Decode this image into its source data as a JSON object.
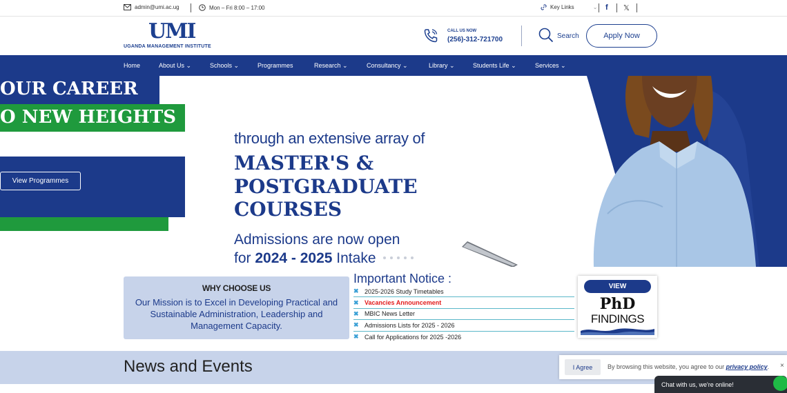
{
  "topbar": {
    "email": "admin@umi.ac.ug",
    "hours": "Mon – Fri 8:00 – 17:00",
    "key_links": "Key Links"
  },
  "header": {
    "logo_mark": "UMI",
    "logo_text": "UGANDA MANAGEMENT INSTITUTE",
    "call_label": "CALL US NOW",
    "call_number": "(256)-312-721700",
    "search_label": "Search",
    "apply_label": "Apply Now"
  },
  "nav": {
    "items": [
      {
        "label": "Home",
        "dropdown": false
      },
      {
        "label": "About Us",
        "dropdown": true
      },
      {
        "label": "Schools",
        "dropdown": true
      },
      {
        "label": "Programmes",
        "dropdown": false
      },
      {
        "label": "Research",
        "dropdown": true
      },
      {
        "label": "Consultancy",
        "dropdown": true
      },
      {
        "label": "Library",
        "dropdown": true
      },
      {
        "label": "Students Life",
        "dropdown": true
      },
      {
        "label": "Services",
        "dropdown": true
      }
    ],
    "chevron": "⌄"
  },
  "hero": {
    "heading1": "OUR CAREER",
    "heading2": "O NEW HEIGHTS",
    "view_programmes": "View Programmes",
    "line1": "through an extensive array of",
    "big1": "MASTER'S &",
    "big2": "POSTGRADUATE",
    "big3": "COURSES",
    "admissions": "Admissions are now open",
    "intake_prefix": "for ",
    "intake_years": "2024 - 2025",
    "intake_suffix": " Intake"
  },
  "why": {
    "title": "WHY CHOOSE US",
    "text": "Our Mission is to Excel in Developing Practical and Sustainable Administration, Leadership and Management Capacity."
  },
  "notice": {
    "title": "Important Notice :",
    "items": [
      {
        "label": "2025-2026 Study Timetables",
        "highlight": false
      },
      {
        "label": "Vacancies Announcement",
        "highlight": true
      },
      {
        "label": "MBIC News Letter",
        "highlight": false
      },
      {
        "label": "Admissions Lists for 2025 - 2026",
        "highlight": false
      },
      {
        "label": "Call for Applications for 2025 -2026",
        "highlight": false
      }
    ]
  },
  "phd": {
    "view": "VIEW",
    "big": "PhD",
    "findings": "FINDINGS"
  },
  "news": {
    "title": "News and Events"
  },
  "cookie": {
    "agree": "I Agree",
    "text": "By browsing this website, you agree to our ",
    "link": "privacy policy",
    "end": ".",
    "close": "×"
  },
  "chat": {
    "text": "Chat with us, we're online!"
  },
  "colors": {
    "brand_blue": "#1c3a8a",
    "brand_green": "#1f9a3d",
    "alert_red": "#e21b1b"
  }
}
